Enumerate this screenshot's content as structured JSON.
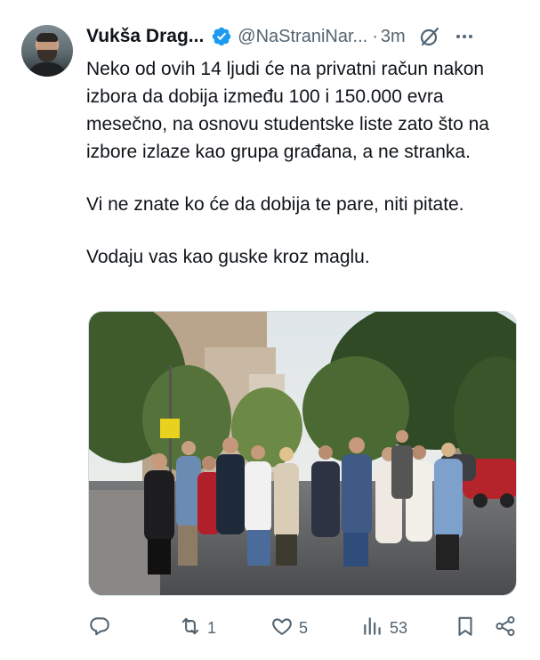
{
  "tweet": {
    "author_name": "Vukša Drag...",
    "handle": "@NaStraniNar...",
    "separator": "·",
    "time": "3m",
    "paragraphs": [
      "Neko od ovih 14 ljudi će na privatni račun nakon izbora da dobija između 100 i 150.000 evra mesečno, na osnovu studentske liste zato što na izbore izlaze kao grupa građana, a ne stranka.",
      "Vi ne znate ko će da dobija te pare, niti pitate.",
      "Vodaju vas kao guske kroz maglu."
    ],
    "metrics": {
      "replies": "",
      "reposts": "1",
      "likes": "5",
      "views": "53"
    }
  },
  "icons": {
    "verified": "verified-badge-icon",
    "grok": "grok-icon",
    "more": "more-icon",
    "reply": "reply-icon",
    "repost": "repost-icon",
    "like": "like-icon",
    "views": "views-icon",
    "bookmark": "bookmark-icon",
    "share": "share-icon"
  },
  "colors": {
    "text": "#0f1419",
    "secondary": "#536471",
    "verified": "#1d9bf0"
  }
}
